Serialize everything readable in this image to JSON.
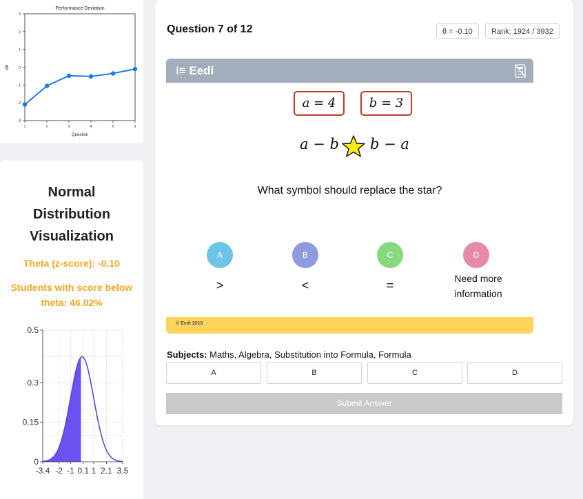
{
  "performance_chart": {
    "chart_data": {
      "type": "line",
      "title": "Performance Deviation",
      "xlabel": "Question",
      "ylabel": "Δθ",
      "x": [
        1,
        2,
        3,
        4,
        5,
        6
      ],
      "y": [
        -2.1,
        -1.05,
        -0.48,
        -0.52,
        -0.35,
        -0.1
      ],
      "xlim": [
        1,
        6
      ],
      "ylim": [
        -3,
        3
      ],
      "xticks": [
        "1",
        "2",
        "3",
        "4",
        "5",
        "6"
      ],
      "yticks": [
        "3",
        "2",
        "1",
        "0",
        "−1",
        "−2",
        "−3"
      ],
      "color": "#1f77e4"
    }
  },
  "distribution": {
    "title_lines": [
      "Normal",
      "Distribution",
      "Visualization"
    ],
    "theta_text": "Theta (z-score): -0.10",
    "below_text_1": "Students with score below",
    "below_text_2": "theta: 46.02%",
    "chart_data": {
      "type": "area",
      "theta": -0.1,
      "xticks": [
        "-3.4",
        "-2",
        "-1",
        "0.1",
        "1",
        "2.1",
        "3.5"
      ],
      "yticks": [
        "0.5",
        "0.3",
        "0.15",
        "0"
      ],
      "line_color": "#6a3fd9",
      "fill_color": "#5b3ff0"
    }
  },
  "question": {
    "title": "Question 7 of 12",
    "theta_pill": "θ = -0.10",
    "rank_pill": "Rank: 1924 / 3932",
    "brand": "Eedi",
    "var_a": "a = 4",
    "var_b": "b = 3",
    "expr_left": "a − b",
    "expr_right": "b − a",
    "prompt": "What symbol should replace the star?",
    "options": [
      {
        "letter": "A",
        "text": ">",
        "color": "#6cc4e6"
      },
      {
        "letter": "B",
        "text": "<",
        "color": "#8e9be0"
      },
      {
        "letter": "C",
        "text": "=",
        "color": "#86d97c"
      },
      {
        "letter": "D",
        "text_1": "Need more",
        "text_2": "information",
        "color": "#e68aa8"
      }
    ],
    "copyright": "© Eedi 2018",
    "subjects_label": "Subjects:",
    "subjects_value": "Maths, Algebra, Substitution into Formula, Formula",
    "answer_buttons": [
      "A",
      "B",
      "C",
      "D"
    ],
    "submit_label": "Submit Answer"
  }
}
